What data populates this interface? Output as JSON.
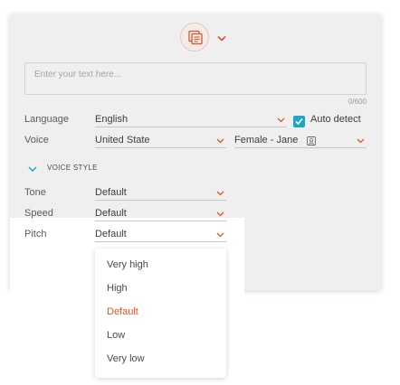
{
  "editor": {
    "placeholder": "Enter your text here...",
    "char_count": "0/600"
  },
  "settings": {
    "language_label": "Language",
    "language_value": "English",
    "auto_detect_label": "Auto detect",
    "auto_detect_checked": true,
    "voice_label": "Voice",
    "voice_region": "United State",
    "voice_name": "Female - Jane"
  },
  "voice_style": {
    "toggle_label": "VOICE STYLE",
    "tone_label": "Tone",
    "tone_value": "Default",
    "speed_label": "Speed",
    "speed_value": "Default",
    "pitch_label": "Pitch",
    "pitch_value": "Default"
  },
  "pitch_dropdown": {
    "options": [
      "Very high",
      "High",
      "Default",
      "Low",
      "Very low"
    ],
    "selected": "Default"
  },
  "colors": {
    "accent": "#d9562c",
    "checkbox": "#1fa6c7",
    "toggle_chevron": "#1fa6c7"
  },
  "icons": {
    "text_mode": "text-documents-icon",
    "caret": "chevron-down-icon",
    "voice_sample": "voice-sample-icon"
  }
}
